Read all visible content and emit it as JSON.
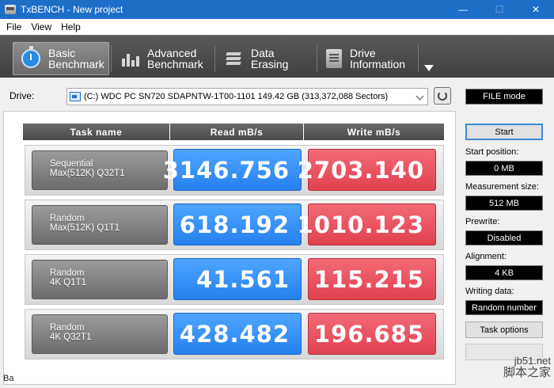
{
  "window": {
    "title": "TxBENCH - New project",
    "minimize": "—",
    "maximize": "☐",
    "close": "✕"
  },
  "menu": [
    "File",
    "View",
    "Help"
  ],
  "tabs": [
    {
      "line1": "Basic",
      "line2": "Benchmark",
      "icon": "stopwatch-icon",
      "active": true
    },
    {
      "line1": "Advanced",
      "line2": "Benchmark",
      "icon": "bar-chart-icon",
      "active": false
    },
    {
      "line1": "Data Erasing",
      "line2": "",
      "icon": "erase-icon",
      "active": false
    },
    {
      "line1": "Drive",
      "line2": "Information",
      "icon": "drive-icon",
      "active": false
    }
  ],
  "drive": {
    "label": "Drive:",
    "selected": "(C:) WDC PC SN720 SDAPNTW-1T00-1101  149.42 GB (313,372,088 Sectors)",
    "mode": "FILE mode"
  },
  "columns": {
    "task": "Task name",
    "read": "Read mB/s",
    "write": "Write mB/s"
  },
  "rows": [
    {
      "name1": "Sequential",
      "name2": "Max(512K) Q32T1",
      "read": "3146.756",
      "write": "2703.140"
    },
    {
      "name1": "Random",
      "name2": "Max(512K) Q1T1",
      "read": "618.192",
      "write": "1010.123"
    },
    {
      "name1": "Random",
      "name2": "4K Q1T1",
      "read": "41.561",
      "write": "115.215"
    },
    {
      "name1": "Random",
      "name2": "4K Q32T1",
      "read": "428.482",
      "write": "196.685"
    }
  ],
  "side": {
    "start": "Start",
    "start_position_label": "Start position:",
    "start_position": "0 MB",
    "measurement_size_label": "Measurement size:",
    "measurement_size": "512 MB",
    "prewrite_label": "Prewrite:",
    "prewrite": "Disabled",
    "alignment_label": "Alignment:",
    "alignment": "4 KB",
    "writing_data_label": "Writing data:",
    "writing_data": "Random number",
    "task_options": "Task options"
  },
  "status": "Ba",
  "watermark": {
    "site": "jb51.net",
    "name": "脚本之家"
  },
  "colors": {
    "read": "#3a93f5",
    "write": "#e9525f",
    "titlebar": "#1e6ec8"
  }
}
